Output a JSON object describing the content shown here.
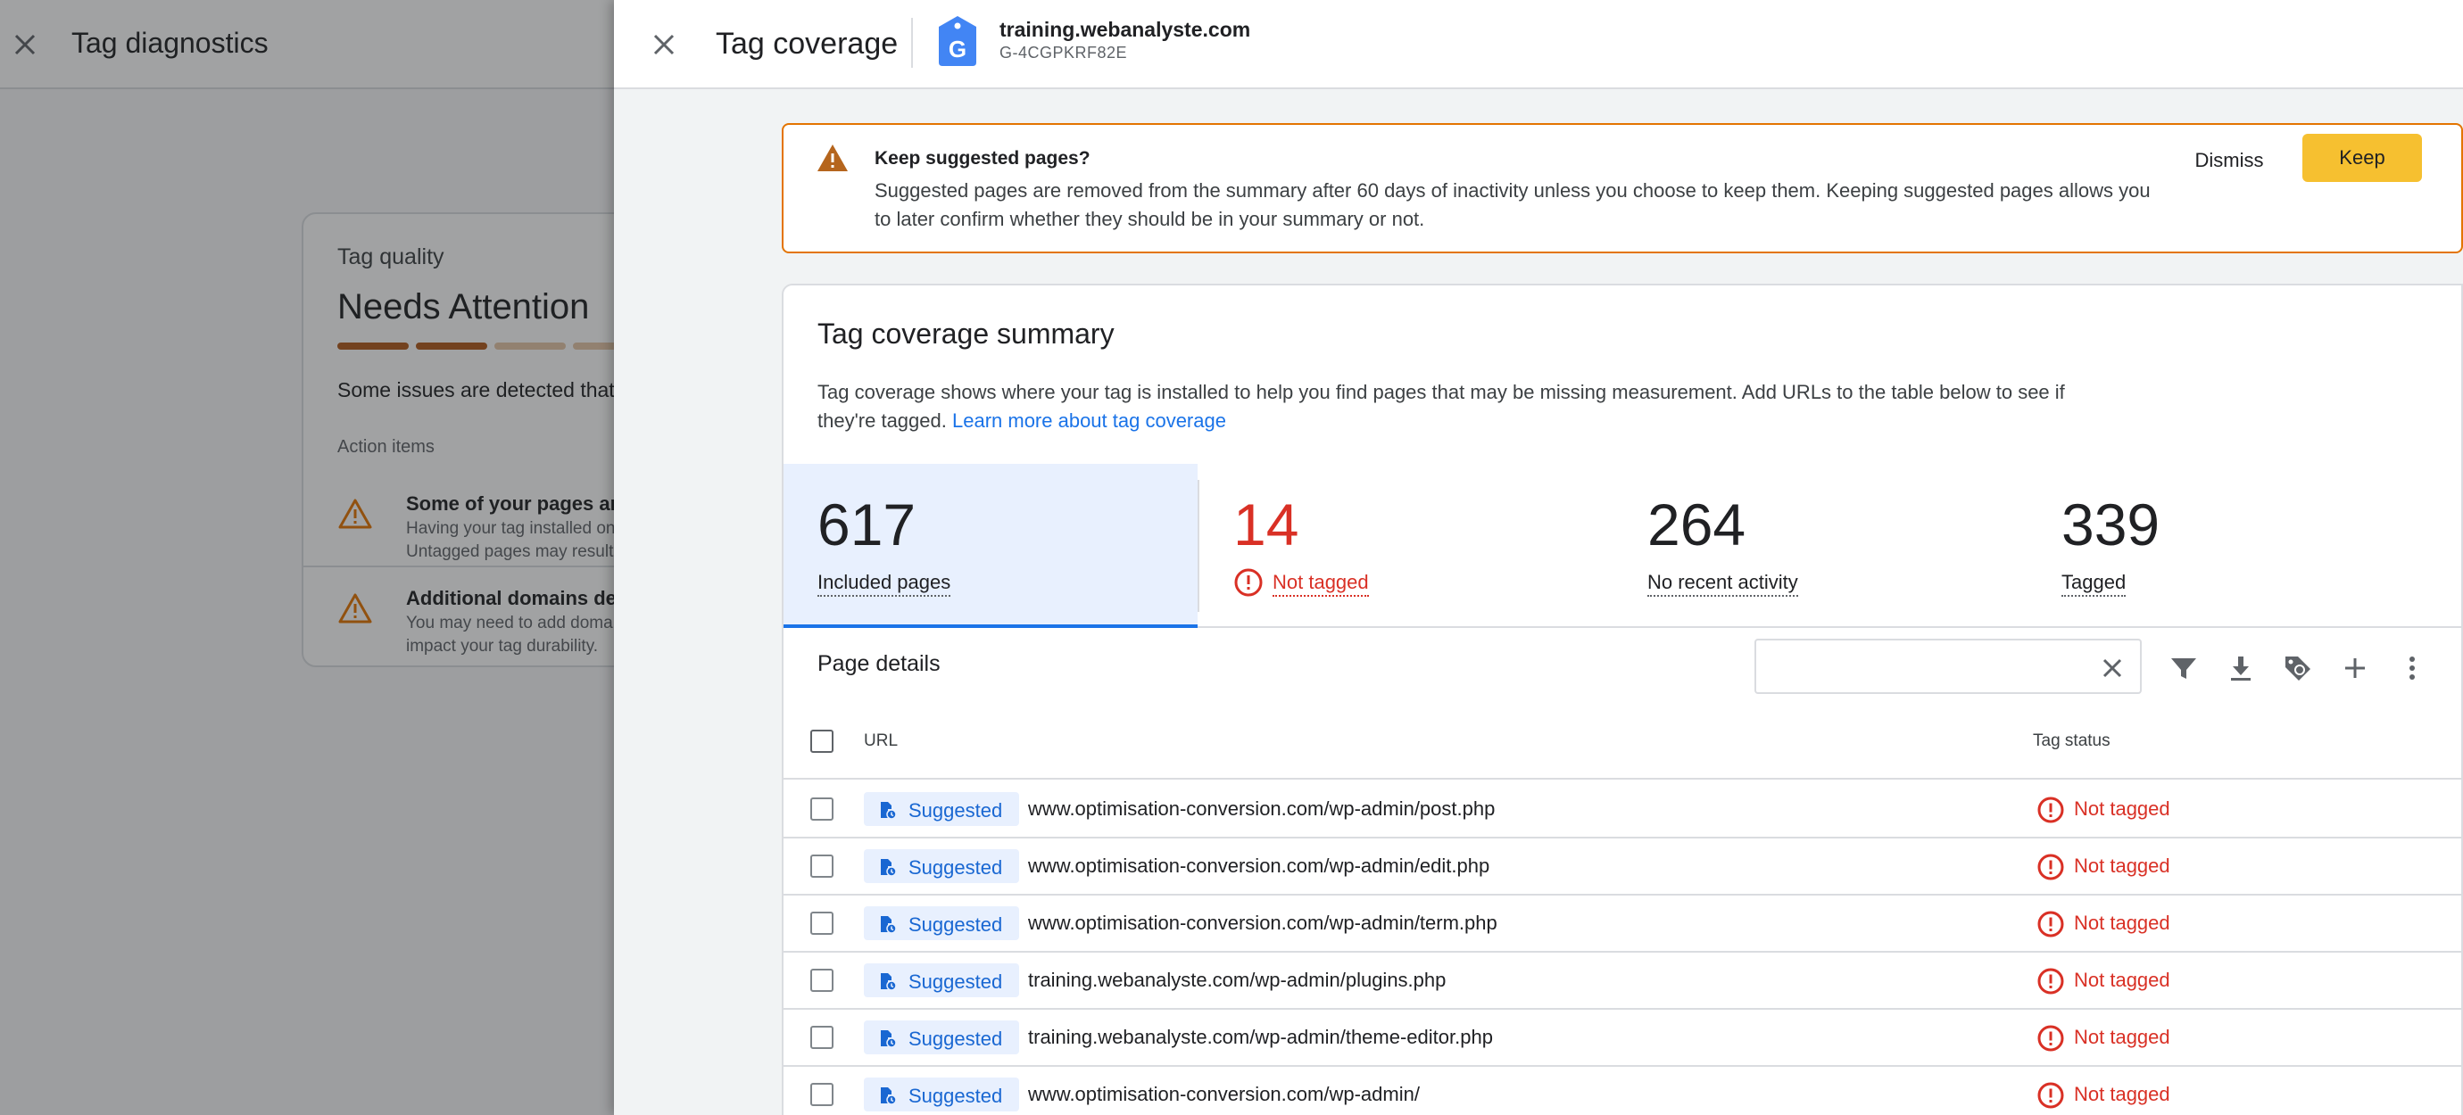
{
  "background": {
    "title": "Tag diagnostics",
    "card": {
      "label": "Tag quality",
      "status": "Needs Attention",
      "quality_bars": [
        "#b05a1c",
        "#b05a1c",
        "#e6c7a8",
        "#e6c7a8",
        "#e6c7a8",
        "#e6c7a8"
      ],
      "summary": "Some issues are detected that may affect your tag's performance.",
      "actions_label": "Action items",
      "items": [
        {
          "title": "Some of your pages are not tagged",
          "description": "Having your tag installed on all of your pages is important. Untagged pages may result in gaps in your data."
        },
        {
          "title": "Additional domains detected for configuration",
          "description": "You may need to add domains to your configuration. This may impact your tag durability."
        }
      ]
    }
  },
  "drawer": {
    "title": "Tag coverage",
    "site_name": "training.webanalyste.com",
    "site_id": "G-4CGPKRF82E",
    "banner": {
      "title": "Keep suggested pages?",
      "text": "Suggested pages are removed from the summary after 60 days of inactivity unless you choose to keep them. Keeping suggested pages allows you to later confirm whether they should be in your summary or not.",
      "dismiss_label": "Dismiss",
      "keep_label": "Keep"
    },
    "summary": {
      "title": "Tag coverage summary",
      "description": "Tag coverage shows where your tag is installed to help you find pages that may be missing measurement. Add URLs to the table below to see if they're tagged.",
      "learn_more": "Learn more about tag coverage",
      "metrics": {
        "included": {
          "value": "617",
          "label": "Included pages"
        },
        "not_tagged": {
          "value": "14",
          "label": "Not tagged"
        },
        "no_activity": {
          "value": "264",
          "label": "No recent activity"
        },
        "tagged": {
          "value": "339",
          "label": "Tagged"
        }
      }
    },
    "details": {
      "title": "Page details",
      "search_value": "",
      "toolbar_icons": [
        "filter-icon",
        "download-icon",
        "tag-icon",
        "add-icon",
        "more-vert-icon"
      ],
      "columns": {
        "url": "URL",
        "status": "Tag status"
      },
      "rows": [
        {
          "chip": "Suggested",
          "url": "www.optimisation-conversion.com/wp-admin/post.php",
          "status": "Not tagged"
        },
        {
          "chip": "Suggested",
          "url": "www.optimisation-conversion.com/wp-admin/edit.php",
          "status": "Not tagged"
        },
        {
          "chip": "Suggested",
          "url": "www.optimisation-conversion.com/wp-admin/term.php",
          "status": "Not tagged"
        },
        {
          "chip": "Suggested",
          "url": "training.webanalyste.com/wp-admin/plugins.php",
          "status": "Not tagged"
        },
        {
          "chip": "Suggested",
          "url": "training.webanalyste.com/wp-admin/theme-editor.php",
          "status": "Not tagged"
        },
        {
          "chip": "Suggested",
          "url": "www.optimisation-conversion.com/wp-admin/",
          "status": "Not tagged"
        }
      ]
    }
  },
  "colors": {
    "accent": "#1a73e8",
    "error": "#d93025",
    "warning": "#e37400",
    "keep_button": "#f6c030"
  }
}
